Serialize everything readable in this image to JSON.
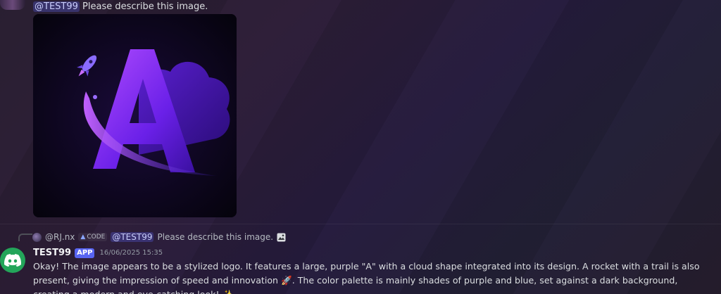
{
  "previous_message": {
    "mention": "@TEST99",
    "text": "Please describe this image."
  },
  "attachment": {
    "alt": "Stylized purple 'A' logo with cloud and rocket"
  },
  "reply_preview": {
    "username": "@RJ.nx",
    "tag": "CODE",
    "mention": "@TEST99",
    "text": "Please describe this image."
  },
  "message": {
    "username": "TEST99",
    "badge": "APP",
    "timestamp": "16/06/2025 15:35",
    "text_part1": "Okay! The image appears to be a stylized logo. It features a large, purple \"A\" with a cloud shape integrated into its design. A rocket with a trail is also present, giving the impression of speed and innovation ",
    "emoji_rocket": "🚀",
    "text_part2": ". The color palette is mainly shades of purple and blue, set against a dark background, creating a modern and eye-catching look! ",
    "emoji_sparkles": "✨"
  },
  "colors": {
    "accent": "#5865f2",
    "bot_avatar": "#23a55a",
    "logo_purple": "#7b2cf0"
  }
}
